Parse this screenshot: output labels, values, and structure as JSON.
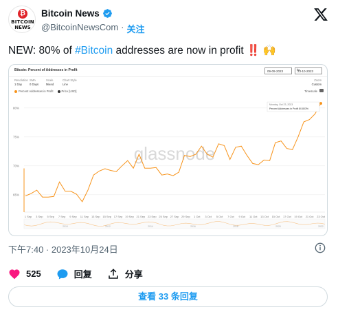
{
  "account": {
    "display_name": "Bitcoin News",
    "handle": "@BitcoinNewsCom",
    "separator": "·",
    "follow_label": "关注",
    "avatar_line1": "BITCOIN",
    "avatar_line2": "NEWS",
    "avatar_symbol": "₿"
  },
  "tweet": {
    "text_prefix": "NEW: 80% of ",
    "hashtag": "#Bitcoin",
    "text_suffix": " addresses are now in profit ",
    "emoji_exclaim": "‼️",
    "emoji_hands": "🙌"
  },
  "media": {
    "title": "Bitcoin: Percent of Addresses in Profit",
    "date_from": "09-09-2023",
    "date_to": "23-10-2023",
    "date_separator": "to",
    "controls": [
      {
        "label": "Resolution",
        "value": "1 Day"
      },
      {
        "label": "SMA",
        "value": "0 Days"
      },
      {
        "label": "Scale",
        "value": "Mixed"
      },
      {
        "label": "Chart Style",
        "value": "Line"
      }
    ],
    "zoom_label": "Zoom",
    "zoom_value": "Custom",
    "legend": [
      {
        "name": "Percent Addresses in Profit",
        "color": "#f7931a"
      },
      {
        "name": "Price [USD]",
        "color": "#333333"
      }
    ],
    "scale_toggle": "Timescale",
    "watermark": "glassnode",
    "tooltip_date": "Monday, Oct 23, 2023",
    "tooltip_series": "Percent Addresses in Profit",
    "tooltip_value": "80.803%",
    "mini_labels": [
      "2010",
      "2012",
      "2014",
      "2016",
      "2018",
      "2020",
      "2022"
    ]
  },
  "chart_data": {
    "type": "line",
    "x": [
      "9 Sep",
      "10 Sep",
      "11 Sep",
      "12 Sep",
      "13 Sep",
      "14 Sep",
      "15 Sep",
      "16 Sep",
      "17 Sep",
      "18 Sep",
      "19 Sep",
      "20 Sep",
      "21 Sep",
      "22 Sep",
      "23 Sep",
      "24 Sep",
      "25 Sep",
      "26 Sep",
      "27 Sep",
      "28 Sep",
      "29 Sep",
      "30 Sep",
      "1 Oct",
      "2 Oct",
      "3 Oct",
      "4 Oct",
      "5 Oct",
      "6 Oct",
      "7 Oct",
      "8 Oct",
      "9 Oct",
      "10 Oct",
      "11 Oct",
      "12 Oct",
      "13 Oct",
      "14 Oct",
      "15 Oct",
      "16 Oct",
      "17 Oct",
      "18 Oct",
      "19 Oct",
      "20 Oct",
      "21 Oct",
      "22 Oct",
      "23 Oct"
    ],
    "xticks": [
      "1 Sep",
      "3 Sep",
      "5 Sep",
      "7 Sep",
      "9 Sep",
      "11 Sep",
      "13 Sep",
      "15 Sep",
      "17 Sep",
      "19 Sep",
      "21 Sep",
      "23 Sep",
      "25 Sep",
      "27 Sep",
      "29 Sep",
      "1 Oct",
      "3 Oct",
      "5 Oct",
      "7 Oct",
      "9 Oct",
      "11 Oct",
      "13 Oct",
      "15 Oct",
      "17 Oct",
      "19 Oct",
      "21 Oct",
      "23 Oct"
    ],
    "series": [
      {
        "name": "Percent Addresses in Profit",
        "values": [
          64.8,
          65.2,
          65.8,
          64.6,
          64.6,
          64.7,
          67.2,
          65.6,
          65.6,
          65.1,
          63.8,
          65.8,
          68.4,
          69.1,
          69.5,
          69.2,
          69.0,
          70.0,
          70.9,
          69.6,
          72.0,
          69.6,
          69.6,
          69.7,
          68.4,
          68.6,
          68.3,
          68.9,
          71.8,
          71.6,
          72.0,
          73.4,
          72.0,
          71.5,
          73.8,
          73.5,
          71.1,
          73.2,
          73.4,
          71.8,
          70.4,
          70.2,
          71.0,
          70.9,
          74.0,
          74.3,
          73.0,
          72.8,
          75.0,
          77.6,
          78.0,
          79.0,
          80.8
        ],
        "color": "#f7931a"
      }
    ],
    "yticks": [
      65,
      70,
      75,
      80
    ],
    "ylim": [
      62,
      82
    ],
    "grid": true,
    "legend_position": "top-left"
  },
  "timestamp": "下午7:40 · 2023年10月24日",
  "actions": {
    "like_count": "525",
    "reply_label": "回复",
    "share_label": "分享"
  },
  "read_replies_label": "查看 33 条回复",
  "colors": {
    "accent": "#1d9bf0",
    "like": "#f91880",
    "chart_line": "#f7931a"
  }
}
